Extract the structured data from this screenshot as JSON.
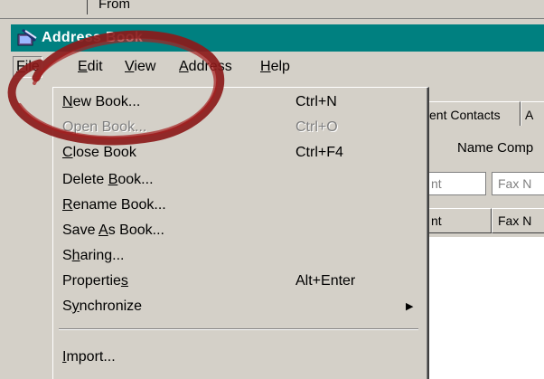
{
  "background_window": {
    "tab_label": "From"
  },
  "window": {
    "title": "Address Book",
    "icon": "address-book-icon"
  },
  "menubar": {
    "items": [
      {
        "label_prefix": "",
        "mnemonic": "F",
        "label_suffix": "ile"
      },
      {
        "label_prefix": "",
        "mnemonic": "E",
        "label_suffix": "dit"
      },
      {
        "label_prefix": "",
        "mnemonic": "V",
        "label_suffix": "iew"
      },
      {
        "label_prefix": "",
        "mnemonic": "A",
        "label_suffix": "ddress"
      },
      {
        "label_prefix": "",
        "mnemonic": "H",
        "label_suffix": "elp"
      }
    ]
  },
  "file_menu": {
    "items": [
      {
        "pre": "",
        "mn": "N",
        "post": "ew Book...",
        "shortcut": "Ctrl+N",
        "enabled": true
      },
      {
        "pre": "",
        "mn": "O",
        "post": "pen Book...",
        "shortcut": "Ctrl+O",
        "enabled": false
      },
      {
        "pre": "",
        "mn": "C",
        "post": "lose Book",
        "shortcut": "Ctrl+F4",
        "enabled": true
      },
      {
        "pre": "Delete ",
        "mn": "B",
        "post": "ook...",
        "shortcut": "",
        "enabled": true
      },
      {
        "pre": "",
        "mn": "R",
        "post": "ename Book...",
        "shortcut": "",
        "enabled": true
      },
      {
        "pre": "Save ",
        "mn": "A",
        "post": "s Book...",
        "shortcut": "",
        "enabled": true
      },
      {
        "pre": "S",
        "mn": "h",
        "post": "aring...",
        "shortcut": "",
        "enabled": true
      },
      {
        "pre": "Propertie",
        "mn": "s",
        "post": "",
        "shortcut": "Alt+Enter",
        "enabled": true
      },
      {
        "pre": "S",
        "mn": "y",
        "post": "nchronize",
        "shortcut": "",
        "enabled": true,
        "submenu": true
      },
      {
        "pre": "",
        "mn": "I",
        "post": "mport...",
        "shortcut": "",
        "enabled": true
      }
    ]
  },
  "background_content": {
    "tab_contacts": "ent Contacts",
    "tab_next": "A",
    "header_text": "Name Comp",
    "field_left": "nt",
    "field_right": "Fax N",
    "col_left": "nt",
    "col_right": "Fax N"
  },
  "colors": {
    "titlebar": "#008080",
    "face": "#d4d0c8",
    "annotation": "#8b1a1a"
  }
}
